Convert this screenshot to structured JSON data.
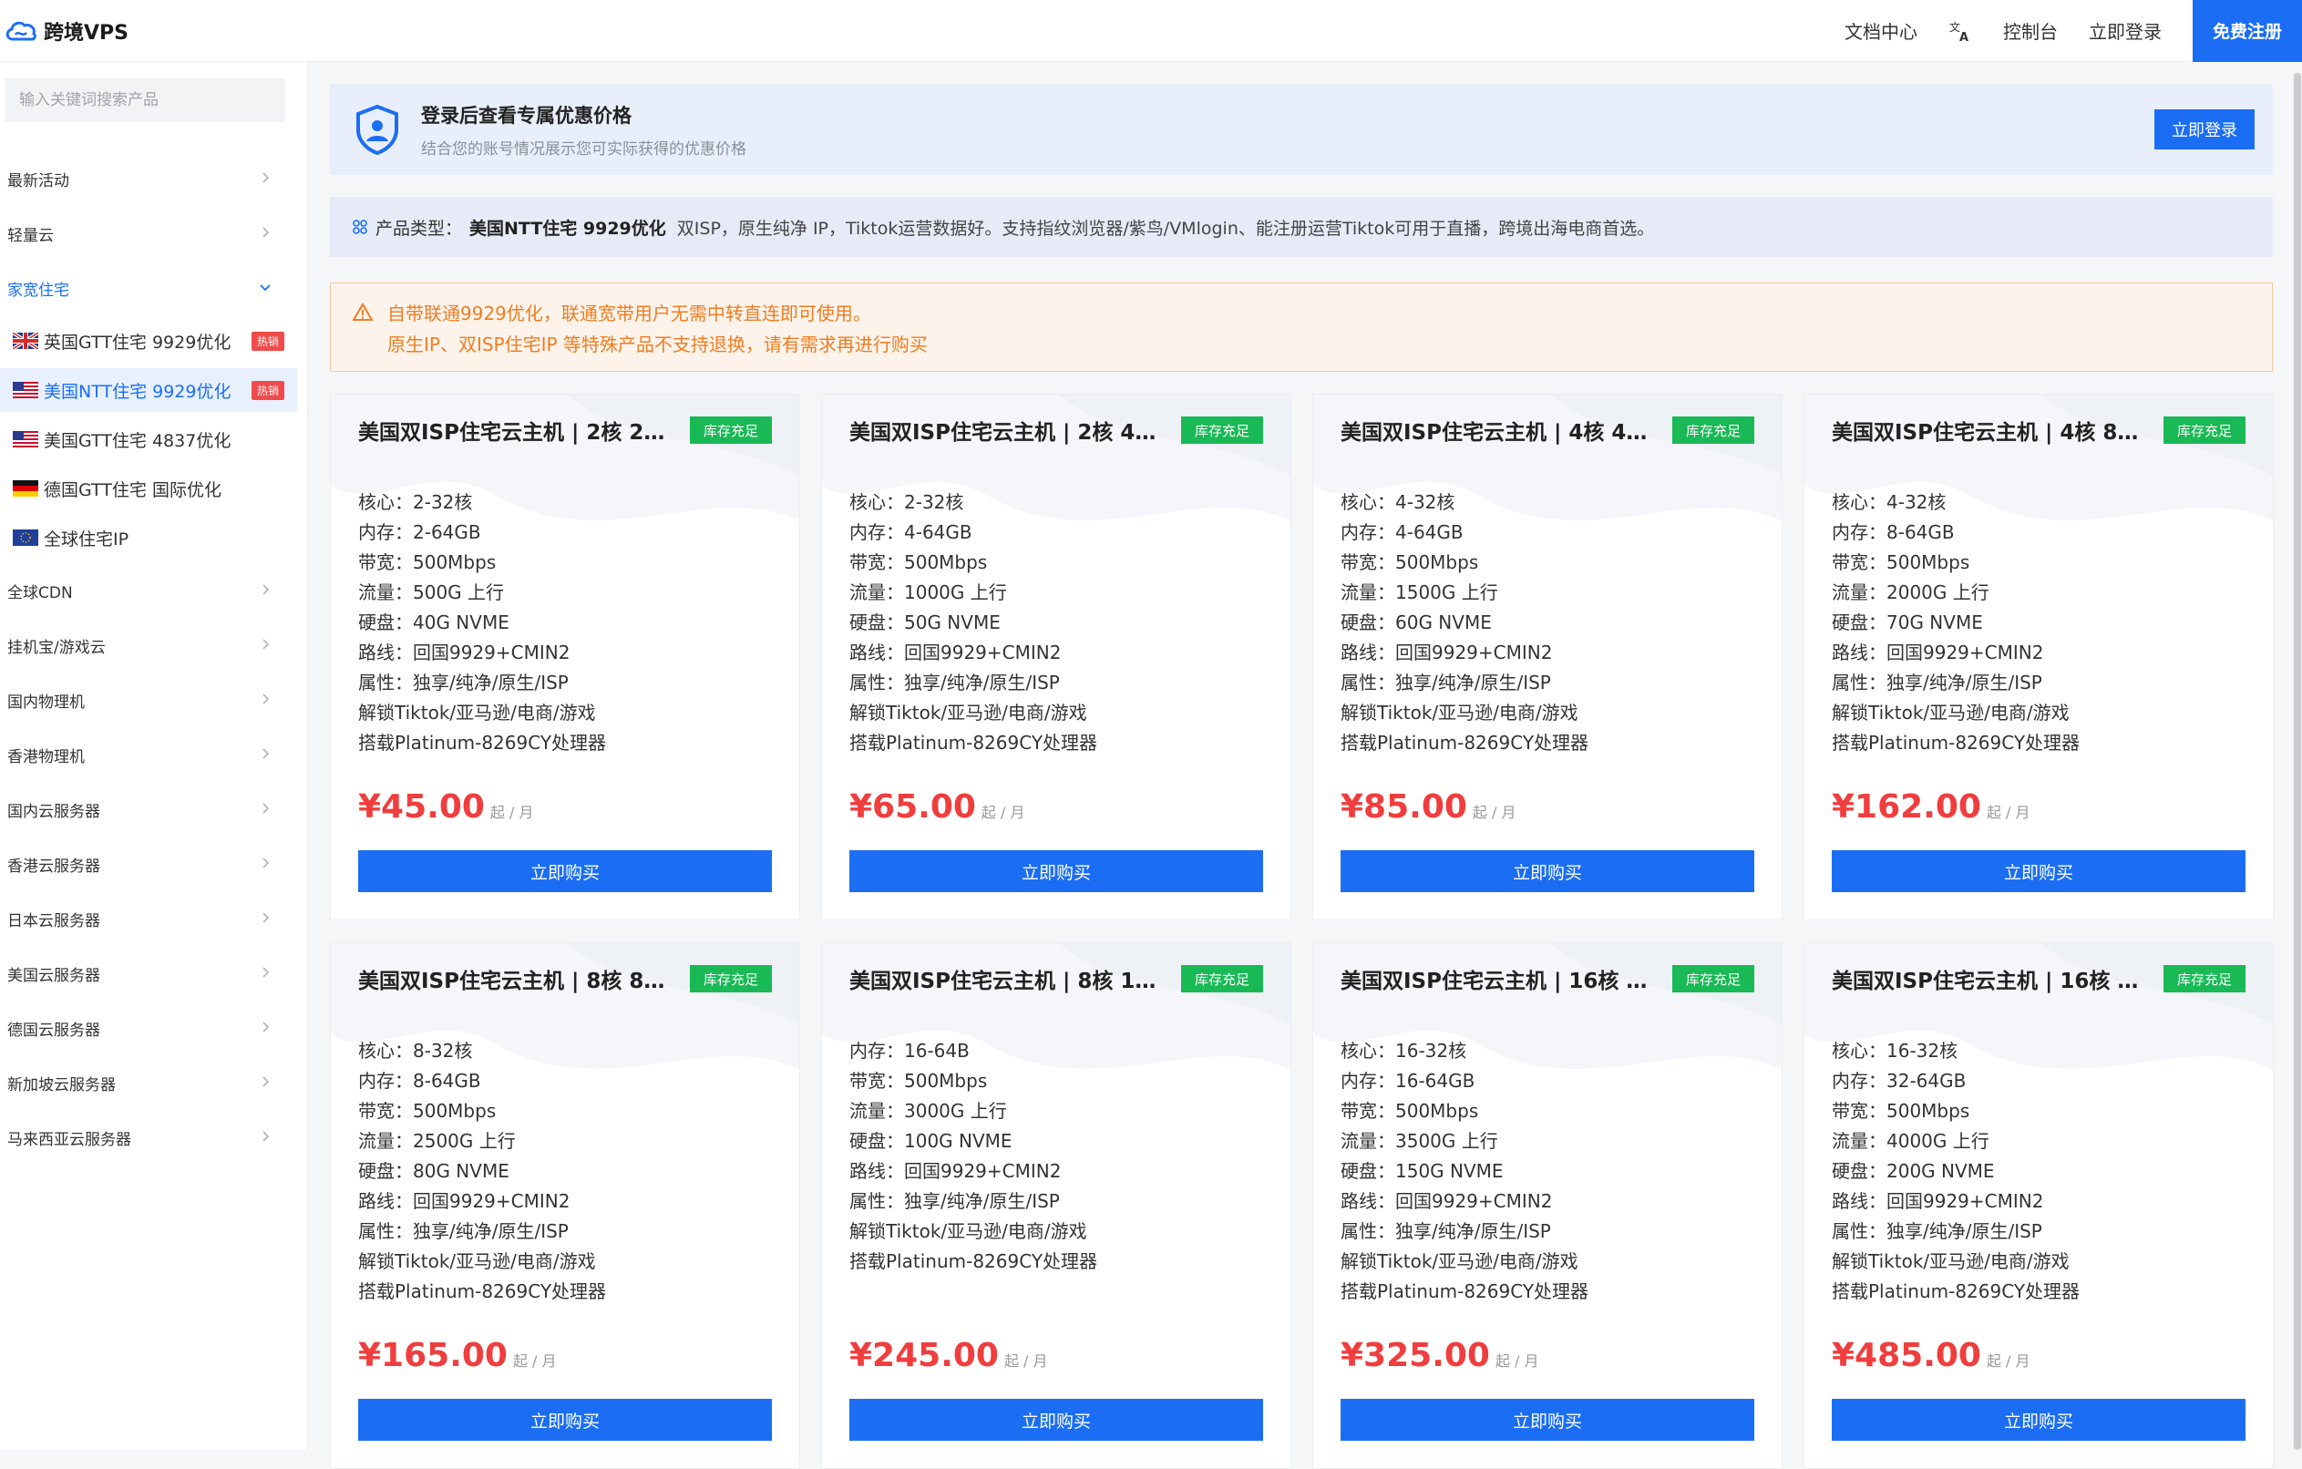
{
  "brand": {
    "name": "跨境VPS"
  },
  "topnav": {
    "docs": "文档中心",
    "console": "控制台",
    "login": "立即登录",
    "register": "免费注册"
  },
  "sidebar": {
    "search_placeholder": "输入关键词搜索产品",
    "menu": [
      {
        "label": "最新活动"
      },
      {
        "label": "轻量云"
      },
      {
        "label": "家宽住宅",
        "expanded": true
      },
      {
        "label": "全球CDN"
      },
      {
        "label": "挂机宝/游戏云"
      },
      {
        "label": "国内物理机"
      },
      {
        "label": "香港物理机"
      },
      {
        "label": "国内云服务器"
      },
      {
        "label": "香港云服务器"
      },
      {
        "label": "日本云服务器"
      },
      {
        "label": "美国云服务器"
      },
      {
        "label": "德国云服务器"
      },
      {
        "label": "新加坡云服务器"
      },
      {
        "label": "马来西亚云服务器"
      }
    ],
    "sub_items": [
      {
        "label": "英国GTT住宅 9929优化",
        "flag": "uk-flag",
        "badge": "热销"
      },
      {
        "label": "美国NTT住宅 9929优化",
        "flag": "us-flag",
        "badge": "热销",
        "selected": true
      },
      {
        "label": "美国GTT住宅 4837优化",
        "flag": "us-flag"
      },
      {
        "label": "德国GTT住宅 国际优化",
        "flag": "de-flag"
      },
      {
        "label": "全球住宅IP",
        "flag": "eu-flag"
      }
    ]
  },
  "banner": {
    "title": "登录后查看专属优惠价格",
    "subtitle": "结合您的账号情况展示您可实际获得的优惠价格",
    "button": "立即登录"
  },
  "product_type": {
    "label": "产品类型：",
    "name": "美国NTT住宅 9929优化",
    "description": "双ISP，原生纯净 IP，Tiktok运营数据好。支持指纹浏览器/紫鸟/VMlogin、能注册运营Tiktok可用于直播，跨境出海电商首选。"
  },
  "notice": {
    "line1": "自带联通9929优化，联通宽带用户无需中转直连即可使用。",
    "line2": "原生IP、双ISP住宅IP 等特殊产品不支持退换，请有需求再进行购买"
  },
  "cards": [
    {
      "title": "美国双ISP住宅云主机 | 2核 2…",
      "stock": "库存充足",
      "specs": [
        "核心：2-32核",
        "内存：2-64GB",
        "带宽：500Mbps",
        "流量：500G 上行",
        "硬盘：40G NVME",
        "路线：回国9929+CMIN2",
        "属性：独享/纯净/原生/ISP",
        "解锁Tiktok/亚马逊/电商/游戏",
        "搭载Platinum-8269CY处理器"
      ],
      "price": "¥45.00",
      "unit": "起 / 月",
      "buy": "立即购买"
    },
    {
      "title": "美国双ISP住宅云主机 | 2核 4…",
      "stock": "库存充足",
      "specs": [
        "核心：2-32核",
        "内存：4-64GB",
        "带宽：500Mbps",
        "流量：1000G 上行",
        "硬盘：50G NVME",
        "路线：回国9929+CMIN2",
        "属性：独享/纯净/原生/ISP",
        "解锁Tiktok/亚马逊/电商/游戏",
        "搭载Platinum-8269CY处理器"
      ],
      "price": "¥65.00",
      "unit": "起 / 月",
      "buy": "立即购买"
    },
    {
      "title": "美国双ISP住宅云主机 | 4核 4…",
      "stock": "库存充足",
      "specs": [
        "核心：4-32核",
        "内存：4-64GB",
        "带宽：500Mbps",
        "流量：1500G 上行",
        "硬盘：60G NVME",
        "路线：回国9929+CMIN2",
        "属性：独享/纯净/原生/ISP",
        "解锁Tiktok/亚马逊/电商/游戏",
        "搭载Platinum-8269CY处理器"
      ],
      "price": "¥85.00",
      "unit": "起 / 月",
      "buy": "立即购买"
    },
    {
      "title": "美国双ISP住宅云主机 | 4核 8…",
      "stock": "库存充足",
      "specs": [
        "核心：4-32核",
        "内存：8-64GB",
        "带宽：500Mbps",
        "流量：2000G 上行",
        "硬盘：70G NVME",
        "路线：回国9929+CMIN2",
        "属性：独享/纯净/原生/ISP",
        "解锁Tiktok/亚马逊/电商/游戏",
        "搭载Platinum-8269CY处理器"
      ],
      "price": "¥162.00",
      "unit": "起 / 月",
      "buy": "立即购买"
    },
    {
      "title": "美国双ISP住宅云主机 | 8核 8…",
      "stock": "库存充足",
      "specs": [
        "核心：8-32核",
        "内存：8-64GB",
        "带宽：500Mbps",
        "流量：2500G 上行",
        "硬盘：80G NVME",
        "路线：回国9929+CMIN2",
        "属性：独享/纯净/原生/ISP",
        "解锁Tiktok/亚马逊/电商/游戏",
        "搭载Platinum-8269CY处理器"
      ],
      "price": "¥165.00",
      "unit": "起 / 月",
      "buy": "立即购买"
    },
    {
      "title": "美国双ISP住宅云主机 | 8核 1…",
      "stock": "库存充足",
      "specs": [
        "内存：16-64B",
        "带宽：500Mbps",
        "流量：3000G 上行",
        "硬盘：100G NVME",
        "路线：回国9929+CMIN2",
        "属性：独享/纯净/原生/ISP",
        "解锁Tiktok/亚马逊/电商/游戏",
        "搭载Platinum-8269CY处理器"
      ],
      "price": "¥245.00",
      "unit": "起 / 月",
      "buy": "立即购买"
    },
    {
      "title": "美国双ISP住宅云主机 | 16核 …",
      "stock": "库存充足",
      "specs": [
        "核心：16-32核",
        "内存：16-64GB",
        "带宽：500Mbps",
        "流量：3500G 上行",
        "硬盘：150G NVME",
        "路线：回国9929+CMIN2",
        "属性：独享/纯净/原生/ISP",
        "解锁Tiktok/亚马逊/电商/游戏",
        "搭载Platinum-8269CY处理器"
      ],
      "price": "¥325.00",
      "unit": "起 / 月",
      "buy": "立即购买"
    },
    {
      "title": "美国双ISP住宅云主机 | 16核 …",
      "stock": "库存充足",
      "specs": [
        "核心：16-32核",
        "内存：32-64GB",
        "带宽：500Mbps",
        "流量：4000G 上行",
        "硬盘：200G NVME",
        "路线：回国9929+CMIN2",
        "属性：独享/纯净/原生/ISP",
        "解锁Tiktok/亚马逊/电商/游戏",
        "搭载Platinum-8269CY处理器"
      ],
      "price": "¥485.00",
      "unit": "起 / 月",
      "buy": "立即购买"
    }
  ],
  "colors": {
    "accent": "#1b6ef3",
    "price": "#f03d3d",
    "stock": "#19b955",
    "hot": "#f04b4b",
    "warning": "#ee7d22"
  }
}
